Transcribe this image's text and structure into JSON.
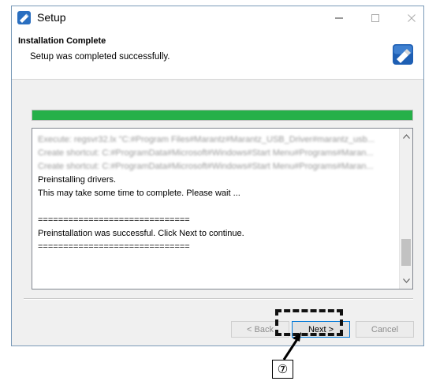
{
  "window": {
    "title": "Setup"
  },
  "header": {
    "title": "Installation Complete",
    "subtitle": "Setup was completed successfully."
  },
  "progress": {
    "fraction": 1.0,
    "color": "#26b049"
  },
  "log": {
    "lines": [
      "Execute: regsvr32.lx \"C:#Program Files#Marantz#Marantz_USB_Driver#marantz_usb...",
      "Create shortcut: C:#ProgramData#Microsoft#Windows#Start Menu#Programs#Maran...",
      "Create shortcut: C:#ProgramData#Microsoft#Windows#Start Menu#Programs#Maran...",
      "Preinstalling drivers.",
      "This may take some time to complete. Please wait ...",
      "",
      "==============================",
      "Preinstallation was successful. Click Next to continue.",
      "=============================="
    ]
  },
  "buttons": {
    "back": "< Back",
    "next": "Next >",
    "cancel": "Cancel"
  },
  "callout": {
    "label": "⑦"
  },
  "icons": {
    "app": "setup-app-icon",
    "header": "usb-drive-icon",
    "minimize": "minimize-icon",
    "maximize": "maximize-icon",
    "close": "close-icon"
  }
}
